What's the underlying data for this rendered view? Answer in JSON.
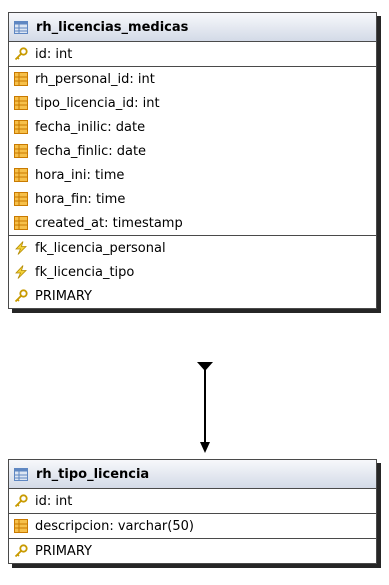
{
  "tables": [
    {
      "name": "rh_licencias_medicas",
      "primary_fields": [
        {
          "label": "id: int",
          "icon": "key-icon"
        }
      ],
      "fields": [
        {
          "label": "rh_personal_id: int",
          "icon": "field-icon"
        },
        {
          "label": "tipo_licencia_id: int",
          "icon": "field-icon"
        },
        {
          "label": "fecha_inilic: date",
          "icon": "field-icon"
        },
        {
          "label": "fecha_finlic: date",
          "icon": "field-icon"
        },
        {
          "label": "hora_ini: time",
          "icon": "field-icon"
        },
        {
          "label": "hora_fin: time",
          "icon": "field-icon"
        },
        {
          "label": "created_at: timestamp",
          "icon": "field-icon"
        }
      ],
      "indexes": [
        {
          "label": "fk_licencia_personal",
          "icon": "foreign-key-icon"
        },
        {
          "label": "fk_licencia_tipo",
          "icon": "foreign-key-icon"
        },
        {
          "label": "PRIMARY",
          "icon": "key-icon"
        }
      ]
    },
    {
      "name": "rh_tipo_licencia",
      "primary_fields": [
        {
          "label": "id: int",
          "icon": "key-icon"
        }
      ],
      "fields": [
        {
          "label": "descripcion: varchar(50)",
          "icon": "field-icon"
        }
      ],
      "indexes": [
        {
          "label": "PRIMARY",
          "icon": "key-icon"
        }
      ]
    }
  ],
  "relations": [
    {
      "from": "rh_licencias_medicas",
      "to": "rh_tipo_licencia"
    }
  ],
  "colors": {
    "field_icon": "#f0a020",
    "key_icon": "#d8a800",
    "foreign_key_icon": "#e8c000",
    "table_icon": "#5f87c2",
    "header_top": "#f7f8fb",
    "header_bottom": "#d3dae7"
  }
}
